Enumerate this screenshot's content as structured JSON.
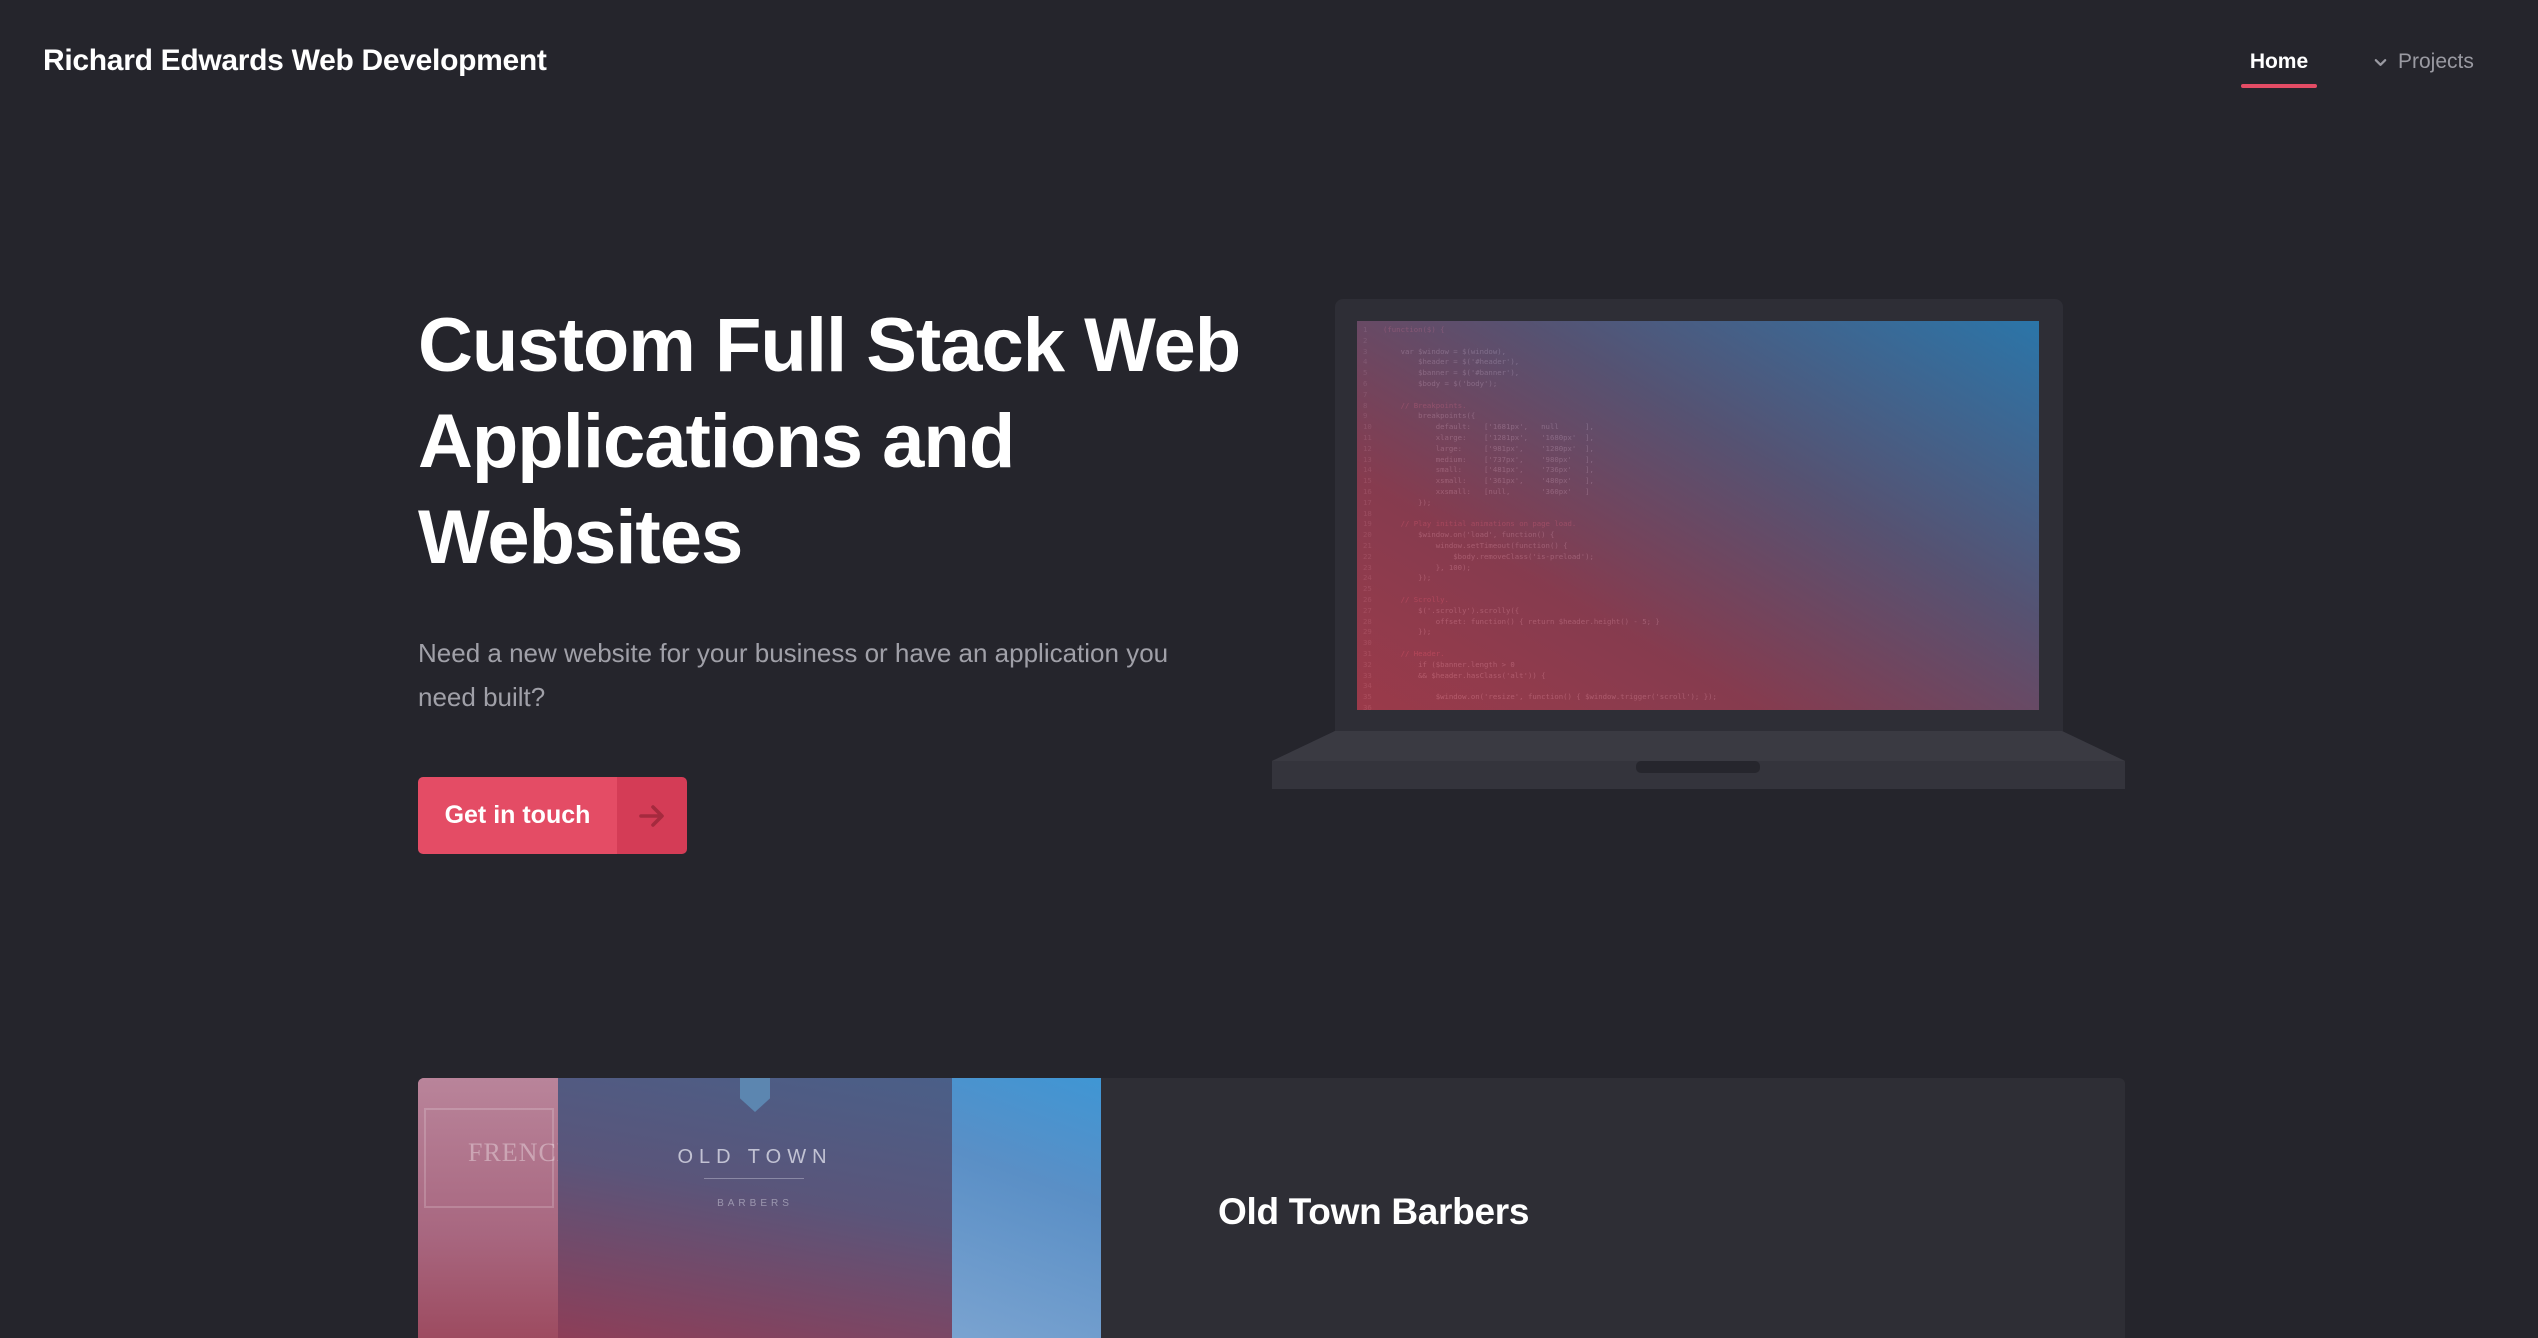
{
  "header": {
    "brand": "Richard Edwards Web Development",
    "nav": [
      {
        "label": "Home",
        "active": true
      },
      {
        "label": "Projects",
        "icon": "chevron-down-icon",
        "active": false
      }
    ]
  },
  "hero": {
    "title": "Custom Full Stack Web Applications and Websites",
    "subtitle": "Need a new website for your business or have an application you need built?",
    "cta": {
      "label": "Get in touch",
      "icon": "arrow-right-icon"
    }
  },
  "project": {
    "title": "Old Town Barbers",
    "image": {
      "brand_text": "OLD TOWN",
      "sub_text": "BARBERS",
      "left_sign": "FRENCH"
    }
  },
  "colors": {
    "background": "#25252c",
    "accent": "#e44c65",
    "accent_dark": "#d43c56",
    "muted_text": "#a0a0a8",
    "card": "#2e2e35"
  }
}
